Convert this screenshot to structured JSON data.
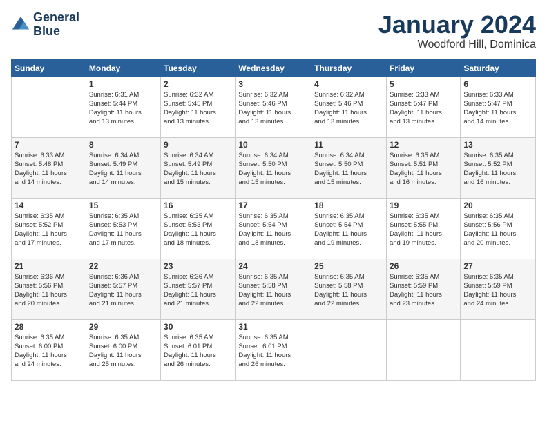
{
  "logo": {
    "line1": "General",
    "line2": "Blue"
  },
  "title": "January 2024",
  "location": "Woodford Hill, Dominica",
  "days_header": [
    "Sunday",
    "Monday",
    "Tuesday",
    "Wednesday",
    "Thursday",
    "Friday",
    "Saturday"
  ],
  "weeks": [
    [
      {
        "day": "",
        "info": ""
      },
      {
        "day": "1",
        "info": "Sunrise: 6:31 AM\nSunset: 5:44 PM\nDaylight: 11 hours\nand 13 minutes."
      },
      {
        "day": "2",
        "info": "Sunrise: 6:32 AM\nSunset: 5:45 PM\nDaylight: 11 hours\nand 13 minutes."
      },
      {
        "day": "3",
        "info": "Sunrise: 6:32 AM\nSunset: 5:46 PM\nDaylight: 11 hours\nand 13 minutes."
      },
      {
        "day": "4",
        "info": "Sunrise: 6:32 AM\nSunset: 5:46 PM\nDaylight: 11 hours\nand 13 minutes."
      },
      {
        "day": "5",
        "info": "Sunrise: 6:33 AM\nSunset: 5:47 PM\nDaylight: 11 hours\nand 13 minutes."
      },
      {
        "day": "6",
        "info": "Sunrise: 6:33 AM\nSunset: 5:47 PM\nDaylight: 11 hours\nand 14 minutes."
      }
    ],
    [
      {
        "day": "7",
        "info": "Sunrise: 6:33 AM\nSunset: 5:48 PM\nDaylight: 11 hours\nand 14 minutes."
      },
      {
        "day": "8",
        "info": "Sunrise: 6:34 AM\nSunset: 5:49 PM\nDaylight: 11 hours\nand 14 minutes."
      },
      {
        "day": "9",
        "info": "Sunrise: 6:34 AM\nSunset: 5:49 PM\nDaylight: 11 hours\nand 15 minutes."
      },
      {
        "day": "10",
        "info": "Sunrise: 6:34 AM\nSunset: 5:50 PM\nDaylight: 11 hours\nand 15 minutes."
      },
      {
        "day": "11",
        "info": "Sunrise: 6:34 AM\nSunset: 5:50 PM\nDaylight: 11 hours\nand 15 minutes."
      },
      {
        "day": "12",
        "info": "Sunrise: 6:35 AM\nSunset: 5:51 PM\nDaylight: 11 hours\nand 16 minutes."
      },
      {
        "day": "13",
        "info": "Sunrise: 6:35 AM\nSunset: 5:52 PM\nDaylight: 11 hours\nand 16 minutes."
      }
    ],
    [
      {
        "day": "14",
        "info": "Sunrise: 6:35 AM\nSunset: 5:52 PM\nDaylight: 11 hours\nand 17 minutes."
      },
      {
        "day": "15",
        "info": "Sunrise: 6:35 AM\nSunset: 5:53 PM\nDaylight: 11 hours\nand 17 minutes."
      },
      {
        "day": "16",
        "info": "Sunrise: 6:35 AM\nSunset: 5:53 PM\nDaylight: 11 hours\nand 18 minutes."
      },
      {
        "day": "17",
        "info": "Sunrise: 6:35 AM\nSunset: 5:54 PM\nDaylight: 11 hours\nand 18 minutes."
      },
      {
        "day": "18",
        "info": "Sunrise: 6:35 AM\nSunset: 5:54 PM\nDaylight: 11 hours\nand 19 minutes."
      },
      {
        "day": "19",
        "info": "Sunrise: 6:35 AM\nSunset: 5:55 PM\nDaylight: 11 hours\nand 19 minutes."
      },
      {
        "day": "20",
        "info": "Sunrise: 6:35 AM\nSunset: 5:56 PM\nDaylight: 11 hours\nand 20 minutes."
      }
    ],
    [
      {
        "day": "21",
        "info": "Sunrise: 6:36 AM\nSunset: 5:56 PM\nDaylight: 11 hours\nand 20 minutes."
      },
      {
        "day": "22",
        "info": "Sunrise: 6:36 AM\nSunset: 5:57 PM\nDaylight: 11 hours\nand 21 minutes."
      },
      {
        "day": "23",
        "info": "Sunrise: 6:36 AM\nSunset: 5:57 PM\nDaylight: 11 hours\nand 21 minutes."
      },
      {
        "day": "24",
        "info": "Sunrise: 6:35 AM\nSunset: 5:58 PM\nDaylight: 11 hours\nand 22 minutes."
      },
      {
        "day": "25",
        "info": "Sunrise: 6:35 AM\nSunset: 5:58 PM\nDaylight: 11 hours\nand 22 minutes."
      },
      {
        "day": "26",
        "info": "Sunrise: 6:35 AM\nSunset: 5:59 PM\nDaylight: 11 hours\nand 23 minutes."
      },
      {
        "day": "27",
        "info": "Sunrise: 6:35 AM\nSunset: 5:59 PM\nDaylight: 11 hours\nand 24 minutes."
      }
    ],
    [
      {
        "day": "28",
        "info": "Sunrise: 6:35 AM\nSunset: 6:00 PM\nDaylight: 11 hours\nand 24 minutes."
      },
      {
        "day": "29",
        "info": "Sunrise: 6:35 AM\nSunset: 6:00 PM\nDaylight: 11 hours\nand 25 minutes."
      },
      {
        "day": "30",
        "info": "Sunrise: 6:35 AM\nSunset: 6:01 PM\nDaylight: 11 hours\nand 26 minutes."
      },
      {
        "day": "31",
        "info": "Sunrise: 6:35 AM\nSunset: 6:01 PM\nDaylight: 11 hours\nand 26 minutes."
      },
      {
        "day": "",
        "info": ""
      },
      {
        "day": "",
        "info": ""
      },
      {
        "day": "",
        "info": ""
      }
    ]
  ]
}
